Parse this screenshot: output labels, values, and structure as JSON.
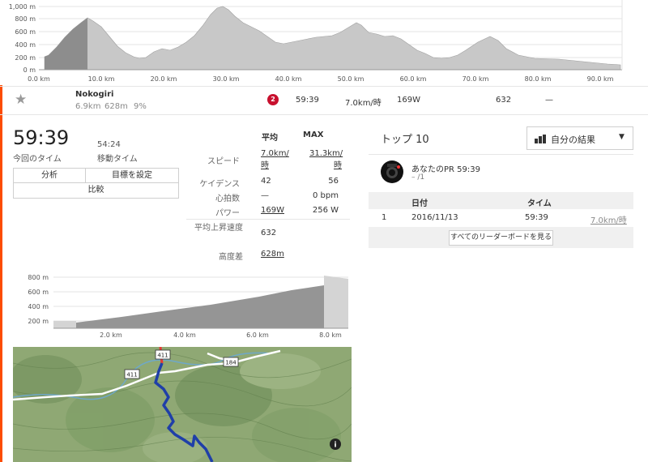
{
  "elevation_profile_top": {
    "y_ticks": [
      "1,000 m",
      "800 m",
      "600 m",
      "400 m",
      "200 m",
      "0 m"
    ],
    "x_ticks": [
      "0.0 km",
      "10.0 km",
      "20.0 km",
      "30.0 km",
      "40.0 km",
      "50.0 km",
      "60.0 km",
      "70.0 km",
      "80.0 km",
      "90.0 km"
    ]
  },
  "segment_row": {
    "star_icon": "star-icon",
    "name": "Nokogiri",
    "distance": "6.9km",
    "elevation": "628m",
    "grade": "9%",
    "rank_badge": "2",
    "time": "59:39",
    "speed": "7.0km/時",
    "power": "169W",
    "vam": "632",
    "dash": "—"
  },
  "summary": {
    "elapsed_time": "59:39",
    "elapsed_label": "今回のタイム",
    "moving_time": "54:24",
    "moving_label": "移動タイム",
    "buttons": {
      "analyze": "分析",
      "set_goal": "目標を設定",
      "compare": "比較"
    }
  },
  "stats": {
    "col_avg": "平均",
    "col_max": "MAX",
    "rows": {
      "speed": {
        "label": "スピード",
        "avg": "7.0km/時",
        "max": "31.3km/時"
      },
      "cadence": {
        "label": "ケイデンス",
        "avg": "42",
        "max": "56"
      },
      "heartrate": {
        "label": "心拍数",
        "avg": "—",
        "max": "0 bpm"
      },
      "power": {
        "label": "パワー",
        "avg": "169W",
        "max": "256 W"
      },
      "vam": {
        "label": "平均上昇速度",
        "value": "632"
      },
      "elevation": {
        "label": "高度差",
        "value": "628m"
      }
    }
  },
  "leaderboard": {
    "title": "トップ 10",
    "filter_label": "自分の結果",
    "pr_title": "あなたのPR 59:39",
    "pr_sub": "– /1",
    "headers": {
      "date": "日付",
      "time": "タイム"
    },
    "rows": [
      {
        "rank": "1",
        "date": "2016/11/13",
        "time": "59:39",
        "speed": "7.0km/時"
      }
    ],
    "view_all": "すべてのリーダーボードを見る"
  },
  "elevation_profile_segment": {
    "y_ticks": [
      "800 m",
      "600 m",
      "400 m",
      "200 m"
    ],
    "x_ticks": [
      "2.0 km",
      "4.0 km",
      "6.0 km",
      "8.0 km"
    ]
  },
  "map": {
    "road_labels": [
      "411",
      "411",
      "184"
    ],
    "info_icon": "info-icon"
  },
  "colors": {
    "accent": "#fc4c02",
    "route": "#1f3fa8",
    "badge": "#c8102e"
  }
}
